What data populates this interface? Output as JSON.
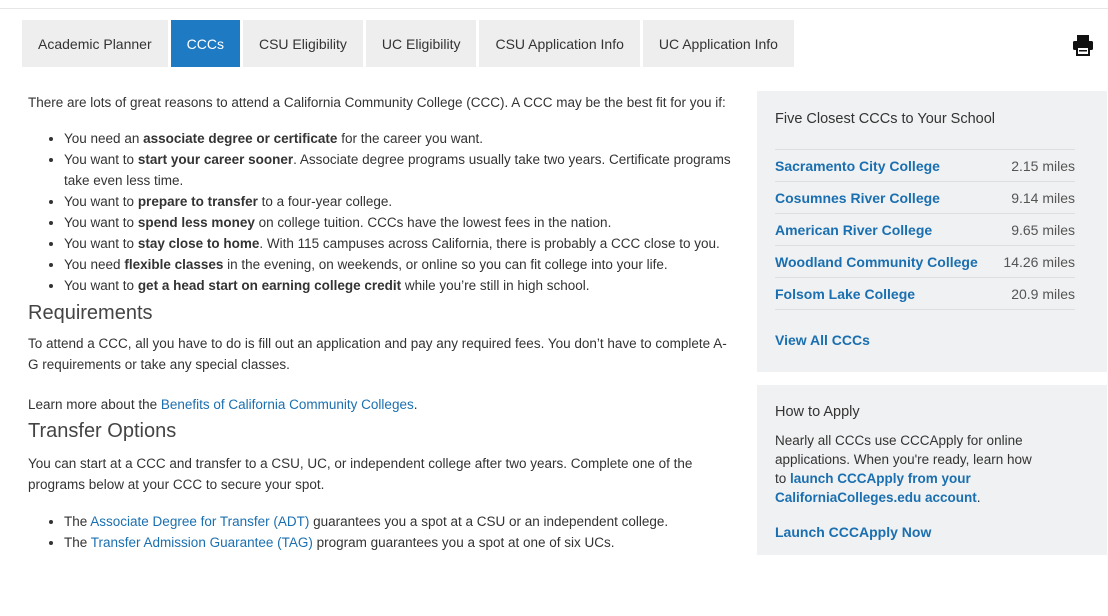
{
  "tabs": [
    {
      "label": "Academic Planner",
      "active": false
    },
    {
      "label": "CCCs",
      "active": true
    },
    {
      "label": "CSU Eligibility",
      "active": false
    },
    {
      "label": "UC Eligibility",
      "active": false
    },
    {
      "label": "CSU Application Info",
      "active": false
    },
    {
      "label": "UC Application Info",
      "active": false
    }
  ],
  "icons": {
    "print": "print-icon"
  },
  "colors": {
    "accent": "#1f7ac4",
    "link": "#1a6fb0",
    "panel": "#f0f1f2",
    "tab": "#eeeeee"
  },
  "intro": "There are lots of great reasons to attend a California Community College (CCC). A CCC may be the best fit for you if:",
  "reasons": [
    {
      "pre": "You need an ",
      "bold": "associate degree or certificate",
      "post": " for the career you want."
    },
    {
      "pre": "You want to ",
      "bold": "start your career sooner",
      "post": ". Associate degree programs usually take two years. Certificate programs take even less time."
    },
    {
      "pre": "You want to ",
      "bold": "prepare to transfer",
      "post": " to a four-year college."
    },
    {
      "pre": "You want to ",
      "bold": "spend less money",
      "post": " on college tuition. CCCs have the lowest fees in the nation."
    },
    {
      "pre": "You want to ",
      "bold": "stay close to home",
      "post": ". With 115 campuses across California, there is probably a CCC close to you."
    },
    {
      "pre": "You need ",
      "bold": "flexible classes",
      "post": " in the evening, on weekends, or online so you can fit college into your life."
    },
    {
      "pre": "You want to ",
      "bold": "get a head start on earning college credit",
      "post": " while you’re still in high school."
    }
  ],
  "requirements": {
    "heading": "Requirements",
    "text": "To attend a CCC, all you have to do is fill out an application and pay any required fees. You don’t have to complete A-G requirements or take any special classes.",
    "learn_pre": "Learn more about the ",
    "learn_link": "Benefits of California Community Colleges",
    "learn_post": "."
  },
  "transfer": {
    "heading": "Transfer Options",
    "text": "You can start at a CCC and transfer to a CSU, UC, or independent college after two years. Complete one of the programs below at your CCC to secure your spot.",
    "items": [
      {
        "pre": "The ",
        "link": "Associate Degree for Transfer (ADT)",
        "post": " guarantees you a spot at a CSU or an independent college."
      },
      {
        "pre": "The ",
        "link": "Transfer Admission Guarantee (TAG)",
        "post": " program guarantees you a spot at one of six UCs."
      }
    ]
  },
  "closest": {
    "heading": "Five Closest CCCs to Your School",
    "colleges": [
      {
        "name": "Sacramento City College",
        "distance": "2.15 miles"
      },
      {
        "name": "Cosumnes River College",
        "distance": "9.14 miles"
      },
      {
        "name": "American River College",
        "distance": "9.65 miles"
      },
      {
        "name": "Woodland Community College",
        "distance": "14.26 miles"
      },
      {
        "name": "Folsom Lake College",
        "distance": "20.9 miles"
      }
    ],
    "view_all": "View All CCCs"
  },
  "apply": {
    "heading": "How to Apply",
    "text_pre": "Nearly all CCCs use CCCApply for online applications. When you're ready, learn how to ",
    "link": "launch CCCApply from your CaliforniaColleges.edu account",
    "text_post": ".",
    "launch": "Launch CCCApply Now"
  }
}
